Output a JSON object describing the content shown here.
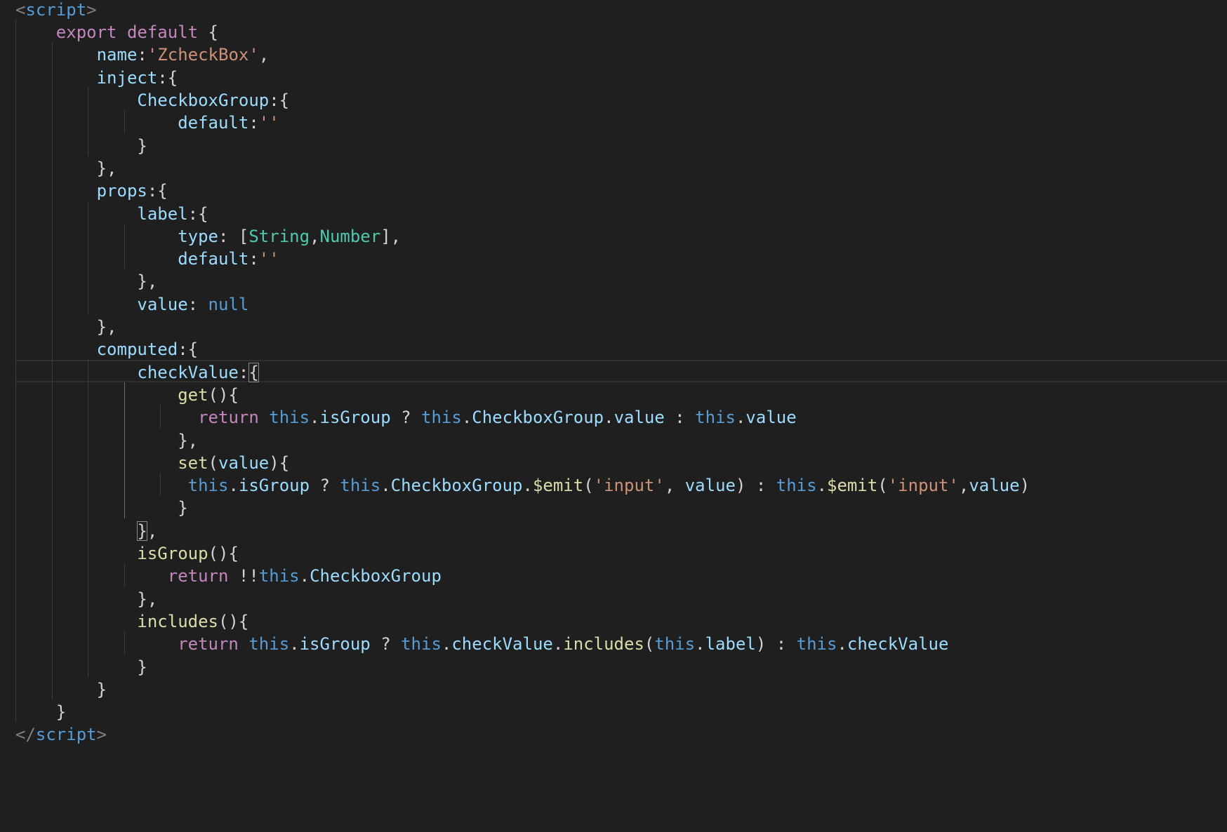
{
  "editor": {
    "language": "vue",
    "theme": {
      "background": "#1f1f1f",
      "tag": "#569cd6",
      "tag_bracket": "#808080",
      "keyword": "#c586c0",
      "storage": "#569cd6",
      "property": "#9cdcfe",
      "string": "#ce9178",
      "type": "#4ec9b0",
      "function": "#dcdcaa",
      "punctuation": "#d4d4d4"
    },
    "lines": [
      {
        "tokens": [
          {
            "t": "<",
            "c": "tag_bracket"
          },
          {
            "t": "script",
            "c": "tag"
          },
          {
            "t": ">",
            "c": "tag_bracket"
          }
        ]
      },
      {
        "tokens": [
          {
            "t": "    "
          },
          {
            "t": "export",
            "c": "keyword"
          },
          {
            "t": " "
          },
          {
            "t": "default",
            "c": "keyword"
          },
          {
            "t": " {"
          }
        ]
      },
      {
        "tokens": [
          {
            "t": "        "
          },
          {
            "t": "name",
            "c": "property"
          },
          {
            "t": ":"
          },
          {
            "t": "'ZcheckBox'",
            "c": "string"
          },
          {
            "t": ","
          }
        ]
      },
      {
        "tokens": [
          {
            "t": "        "
          },
          {
            "t": "inject",
            "c": "property"
          },
          {
            "t": ":{"
          }
        ]
      },
      {
        "tokens": [
          {
            "t": "            "
          },
          {
            "t": "CheckboxGroup",
            "c": "property"
          },
          {
            "t": ":{"
          }
        ]
      },
      {
        "tokens": [
          {
            "t": "                "
          },
          {
            "t": "default",
            "c": "property"
          },
          {
            "t": ":"
          },
          {
            "t": "''",
            "c": "string"
          }
        ]
      },
      {
        "tokens": [
          {
            "t": "            }"
          }
        ]
      },
      {
        "tokens": [
          {
            "t": "        },"
          }
        ]
      },
      {
        "tokens": [
          {
            "t": "        "
          },
          {
            "t": "props",
            "c": "property"
          },
          {
            "t": ":{"
          }
        ]
      },
      {
        "tokens": [
          {
            "t": "            "
          },
          {
            "t": "label",
            "c": "property"
          },
          {
            "t": ":{"
          }
        ]
      },
      {
        "tokens": [
          {
            "t": "                "
          },
          {
            "t": "type",
            "c": "property"
          },
          {
            "t": ": ["
          },
          {
            "t": "String",
            "c": "type"
          },
          {
            "t": ","
          },
          {
            "t": "Number",
            "c": "type"
          },
          {
            "t": "],"
          }
        ]
      },
      {
        "tokens": [
          {
            "t": "                "
          },
          {
            "t": "default",
            "c": "property"
          },
          {
            "t": ":"
          },
          {
            "t": "''",
            "c": "string"
          }
        ]
      },
      {
        "tokens": [
          {
            "t": "            },"
          }
        ]
      },
      {
        "tokens": [
          {
            "t": "            "
          },
          {
            "t": "value",
            "c": "property"
          },
          {
            "t": ": "
          },
          {
            "t": "null",
            "c": "storage"
          }
        ]
      },
      {
        "tokens": [
          {
            "t": "        },"
          }
        ]
      },
      {
        "tokens": [
          {
            "t": "        "
          },
          {
            "t": "computed",
            "c": "property"
          },
          {
            "t": ":{"
          }
        ]
      },
      {
        "current": true,
        "tokens": [
          {
            "t": "            "
          },
          {
            "t": "checkValue",
            "c": "property"
          },
          {
            "t": ":"
          },
          {
            "t": "{",
            "box": true
          }
        ]
      },
      {
        "tokens": [
          {
            "t": "                "
          },
          {
            "t": "get",
            "c": "function"
          },
          {
            "t": "(){"
          }
        ]
      },
      {
        "tokens": [
          {
            "t": "                  "
          },
          {
            "t": "return",
            "c": "keyword"
          },
          {
            "t": " "
          },
          {
            "t": "this",
            "c": "storage"
          },
          {
            "t": "."
          },
          {
            "t": "isGroup",
            "c": "property"
          },
          {
            "t": " ? "
          },
          {
            "t": "this",
            "c": "storage"
          },
          {
            "t": "."
          },
          {
            "t": "CheckboxGroup",
            "c": "property"
          },
          {
            "t": "."
          },
          {
            "t": "value",
            "c": "property"
          },
          {
            "t": " : "
          },
          {
            "t": "this",
            "c": "storage"
          },
          {
            "t": "."
          },
          {
            "t": "value",
            "c": "property"
          }
        ]
      },
      {
        "tokens": [
          {
            "t": "                },"
          }
        ]
      },
      {
        "tokens": [
          {
            "t": "                "
          },
          {
            "t": "set",
            "c": "function"
          },
          {
            "t": "("
          },
          {
            "t": "value",
            "c": "property"
          },
          {
            "t": "){"
          }
        ]
      },
      {
        "tokens": [
          {
            "t": "                 "
          },
          {
            "t": "this",
            "c": "storage"
          },
          {
            "t": "."
          },
          {
            "t": "isGroup",
            "c": "property"
          },
          {
            "t": " ? "
          },
          {
            "t": "this",
            "c": "storage"
          },
          {
            "t": "."
          },
          {
            "t": "CheckboxGroup",
            "c": "property"
          },
          {
            "t": "."
          },
          {
            "t": "$emit",
            "c": "function"
          },
          {
            "t": "("
          },
          {
            "t": "'input'",
            "c": "string"
          },
          {
            "t": ", "
          },
          {
            "t": "value",
            "c": "property"
          },
          {
            "t": ") : "
          },
          {
            "t": "this",
            "c": "storage"
          },
          {
            "t": "."
          },
          {
            "t": "$emit",
            "c": "function"
          },
          {
            "t": "("
          },
          {
            "t": "'input'",
            "c": "string"
          },
          {
            "t": ","
          },
          {
            "t": "value",
            "c": "property"
          },
          {
            "t": ")"
          }
        ]
      },
      {
        "tokens": [
          {
            "t": "                }"
          }
        ]
      },
      {
        "tokens": [
          {
            "t": "            "
          },
          {
            "t": "}",
            "box": true
          },
          {
            "t": ","
          }
        ]
      },
      {
        "tokens": [
          {
            "t": "            "
          },
          {
            "t": "isGroup",
            "c": "function"
          },
          {
            "t": "(){"
          }
        ]
      },
      {
        "tokens": [
          {
            "t": "               "
          },
          {
            "t": "return",
            "c": "keyword"
          },
          {
            "t": " !!"
          },
          {
            "t": "this",
            "c": "storage"
          },
          {
            "t": "."
          },
          {
            "t": "CheckboxGroup",
            "c": "property"
          }
        ]
      },
      {
        "tokens": [
          {
            "t": "            },"
          }
        ]
      },
      {
        "tokens": [
          {
            "t": "            "
          },
          {
            "t": "includes",
            "c": "function"
          },
          {
            "t": "(){"
          }
        ]
      },
      {
        "tokens": [
          {
            "t": "                "
          },
          {
            "t": "return",
            "c": "keyword"
          },
          {
            "t": " "
          },
          {
            "t": "this",
            "c": "storage"
          },
          {
            "t": "."
          },
          {
            "t": "isGroup",
            "c": "property"
          },
          {
            "t": " ? "
          },
          {
            "t": "this",
            "c": "storage"
          },
          {
            "t": "."
          },
          {
            "t": "checkValue",
            "c": "property"
          },
          {
            "t": "."
          },
          {
            "t": "includes",
            "c": "function"
          },
          {
            "t": "("
          },
          {
            "t": "this",
            "c": "storage"
          },
          {
            "t": "."
          },
          {
            "t": "label",
            "c": "property"
          },
          {
            "t": ") : "
          },
          {
            "t": "this",
            "c": "storage"
          },
          {
            "t": "."
          },
          {
            "t": "checkValue",
            "c": "property"
          }
        ]
      },
      {
        "tokens": [
          {
            "t": "            }"
          }
        ]
      },
      {
        "tokens": [
          {
            "t": "        }"
          }
        ]
      },
      {
        "tokens": [
          {
            "t": "    }"
          }
        ]
      },
      {
        "tokens": [
          {
            "t": "</",
            "c": "tag_bracket"
          },
          {
            "t": "script",
            "c": "tag"
          },
          {
            "t": ">",
            "c": "tag_bracket"
          }
        ]
      }
    ]
  }
}
